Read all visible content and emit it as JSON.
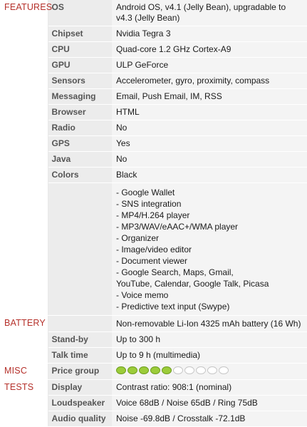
{
  "sections": {
    "features": "FEATURES",
    "battery": "BATTERY",
    "misc": "MISC",
    "tests": "TESTS"
  },
  "features": {
    "os": {
      "label": "OS",
      "value": "Android OS, v4.1 (Jelly Bean), upgradable to v4.3 (Jelly Bean)"
    },
    "chipset": {
      "label": "Chipset",
      "value": "Nvidia Tegra 3"
    },
    "cpu": {
      "label": "CPU",
      "value": "Quad-core 1.2 GHz Cortex-A9"
    },
    "gpu": {
      "label": "GPU",
      "value": "ULP GeForce"
    },
    "sensors": {
      "label": "Sensors",
      "value": "Accelerometer, gyro, proximity, compass"
    },
    "messaging": {
      "label": "Messaging",
      "value": "Email, Push Email, IM, RSS"
    },
    "browser": {
      "label": "Browser",
      "value": "HTML"
    },
    "radio": {
      "label": "Radio",
      "value": "No"
    },
    "gps": {
      "label": "GPS",
      "value": "Yes"
    },
    "java": {
      "label": "Java",
      "value": "No"
    },
    "colors": {
      "label": "Colors",
      "value": "Black"
    },
    "extras": [
      "- Google Wallet",
      "- SNS integration",
      "- MP4/H.264 player",
      "- MP3/WAV/eAAC+/WMA player",
      "- Organizer",
      "- Image/video editor",
      "- Document viewer",
      "- Google Search, Maps, Gmail,",
      "YouTube, Calendar, Google Talk, Picasa",
      "- Voice memo",
      "- Predictive text input (Swype)"
    ]
  },
  "battery": {
    "type": "Non-removable Li-Ion 4325 mAh battery (16 Wh)",
    "standby": {
      "label": "Stand-by",
      "value": "Up to 300 h"
    },
    "talktime": {
      "label": "Talk time",
      "value": "Up to 9 h (multimedia)"
    }
  },
  "misc": {
    "price_group": {
      "label": "Price group",
      "filled": 5,
      "total": 10
    }
  },
  "tests": {
    "display": {
      "label": "Display",
      "value": "Contrast ratio: 908:1 (nominal)"
    },
    "loudspeaker": {
      "label": "Loudspeaker",
      "value": "Voice 68dB / Noise 65dB / Ring 75dB"
    },
    "audio": {
      "label": "Audio quality",
      "value": "Noise -69.8dB / Crosstalk -72.1dB"
    }
  },
  "colors": {
    "category": "#b5302a",
    "label_bg": "#ececec",
    "value_bg": "#f4f4f4",
    "coin_on": "#9ccc3a"
  }
}
